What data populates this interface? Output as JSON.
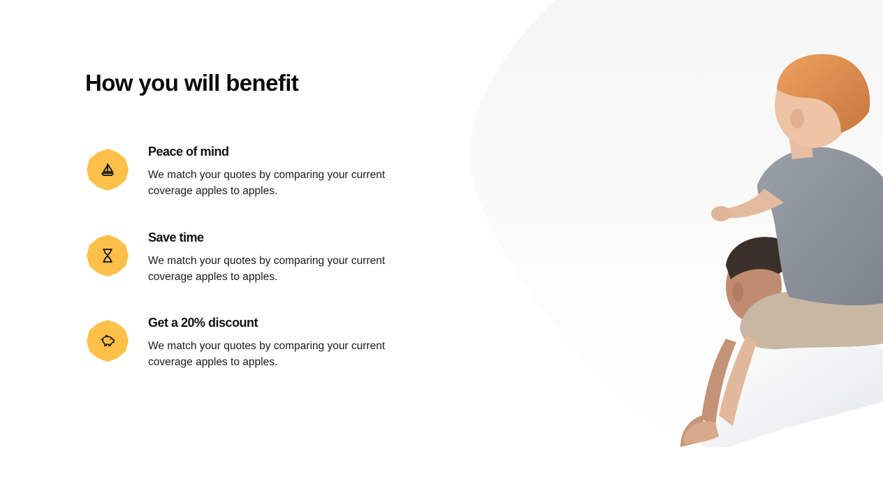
{
  "section": {
    "title": "How you will benefit"
  },
  "benefits": [
    {
      "title": "Peace of mind",
      "description": "We match your quotes by comparing your current coverage apples to apples.",
      "icon": "sailboat-icon"
    },
    {
      "title": "Save time",
      "description": "We match your quotes by comparing your current coverage apples to apples.",
      "icon": "hourglass-icon"
    },
    {
      "title": "Get a 20% discount",
      "description": "We match your quotes by comparing your current coverage apples to apples.",
      "icon": "piggy-bank-icon"
    }
  ],
  "colors": {
    "badge": "#FFC04A",
    "icon_stroke": "#111111",
    "heading": "#0a0a0a"
  }
}
